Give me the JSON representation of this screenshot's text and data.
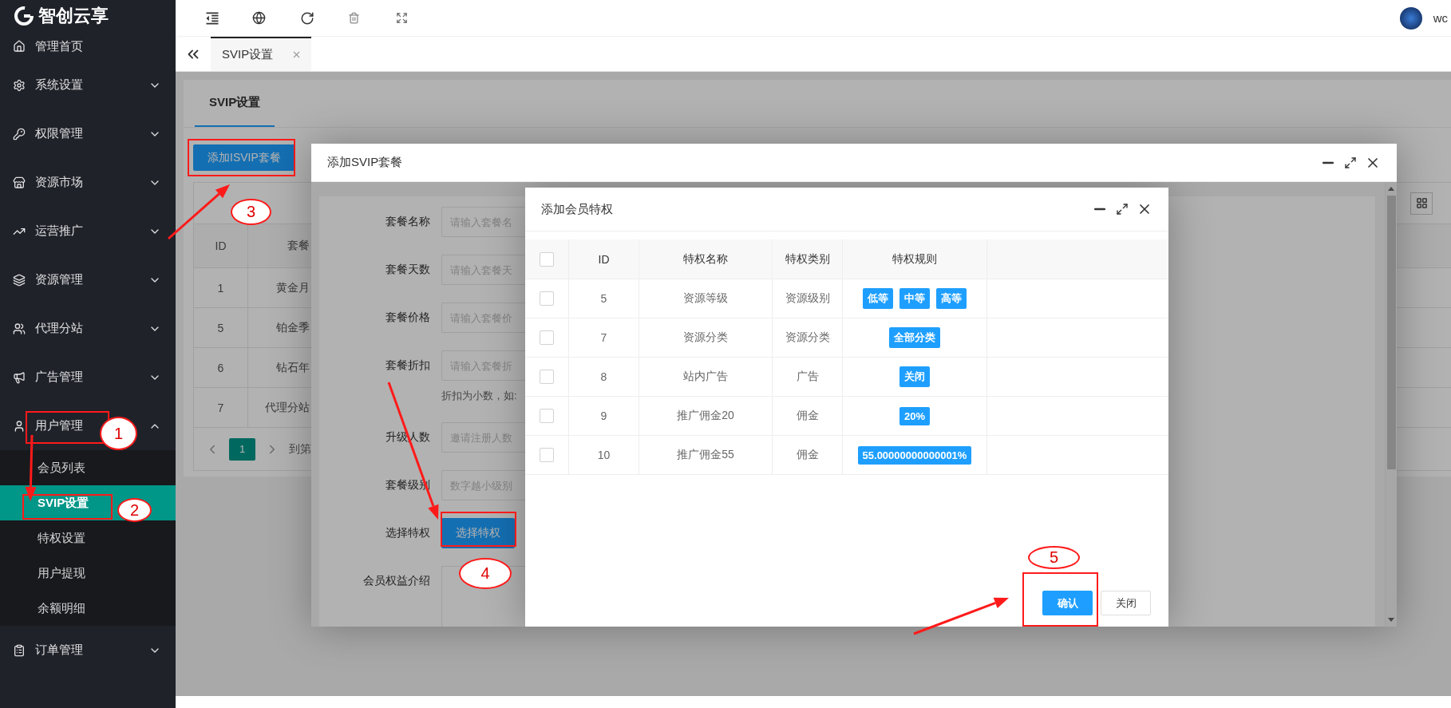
{
  "logo": {
    "text": "智创云享"
  },
  "sidebar": {
    "items": [
      {
        "label": "管理首页"
      },
      {
        "label": "系统设置",
        "expanded": false
      },
      {
        "label": "权限管理",
        "expanded": false
      },
      {
        "label": "资源市场",
        "expanded": false
      },
      {
        "label": "运营推广",
        "expanded": false
      },
      {
        "label": "资源管理",
        "expanded": false
      },
      {
        "label": "代理分站",
        "expanded": false
      },
      {
        "label": "广告管理",
        "expanded": false
      },
      {
        "label": "用户管理",
        "expanded": true,
        "children": [
          {
            "label": "会员列表",
            "selected": false
          },
          {
            "label": "SVIP设置",
            "selected": true
          },
          {
            "label": "特权设置",
            "selected": false
          },
          {
            "label": "用户提现",
            "selected": false
          },
          {
            "label": "余额明细",
            "selected": false
          }
        ]
      },
      {
        "label": "订单管理",
        "expanded": false
      }
    ]
  },
  "header": {
    "user": "wc"
  },
  "tabs": [
    {
      "label": "SVIP设置",
      "selected": true
    }
  ],
  "page": {
    "title": "SVIP设置",
    "add_button": "添加ISVIP套餐",
    "table": {
      "columns": [
        "ID",
        "套餐"
      ],
      "rows": [
        [
          "1",
          "黄金月"
        ],
        [
          "5",
          "铂金季"
        ],
        [
          "6",
          "钻石年"
        ],
        [
          "7",
          "代理分站"
        ]
      ]
    },
    "pagination": {
      "current": "1",
      "goto": "到第"
    }
  },
  "dialog": {
    "title": "添加SVIP套餐",
    "form": [
      {
        "kind": "input",
        "label": "套餐名称",
        "placeholder": "请输入套餐名"
      },
      {
        "kind": "input",
        "label": "套餐天数",
        "placeholder": "请输入套餐天"
      },
      {
        "kind": "input",
        "label": "套餐价格",
        "placeholder": "请输入套餐价"
      },
      {
        "kind": "input",
        "label": "套餐折扣",
        "placeholder": "请输入套餐折"
      },
      {
        "kind": "hint",
        "text": "折扣为小数，如:"
      },
      {
        "kind": "input",
        "label": "升级人数",
        "placeholder": "邀请注册人数"
      },
      {
        "kind": "input",
        "label": "套餐级别",
        "placeholder": "数字越小级别"
      },
      {
        "kind": "button",
        "label": "选择特权",
        "button": "选择特权"
      },
      {
        "kind": "textarea",
        "label": "会员权益介绍"
      }
    ]
  },
  "privilege_dialog": {
    "title": "添加会员特权",
    "select_all": {
      "checked": false
    },
    "columns": [
      "ID",
      "特权名称",
      "特权类别",
      "特权规则"
    ],
    "rows": [
      {
        "checked": false,
        "id": "5",
        "name": "资源等级",
        "category": "资源级别",
        "rules": [
          "低等",
          "中等",
          "高等"
        ]
      },
      {
        "checked": false,
        "id": "7",
        "name": "资源分类",
        "category": "资源分类",
        "rules": [
          "全部分类"
        ]
      },
      {
        "checked": false,
        "id": "8",
        "name": "站内广告",
        "category": "广告",
        "rules": [
          "关闭"
        ]
      },
      {
        "checked": false,
        "id": "9",
        "name": "推广佣金20",
        "category": "佣金",
        "rules": [
          "20%"
        ]
      },
      {
        "checked": false,
        "id": "10",
        "name": "推广佣金55",
        "category": "佣金",
        "rules": [
          "55.00000000000001%"
        ]
      }
    ],
    "buttons": [
      {
        "label": "确认",
        "kind": "primary"
      },
      {
        "label": "关闭",
        "kind": "default"
      }
    ]
  },
  "annotations": [
    {
      "number": "1"
    },
    {
      "number": "2"
    },
    {
      "number": "3"
    },
    {
      "number": "4"
    },
    {
      "number": "5"
    }
  ]
}
